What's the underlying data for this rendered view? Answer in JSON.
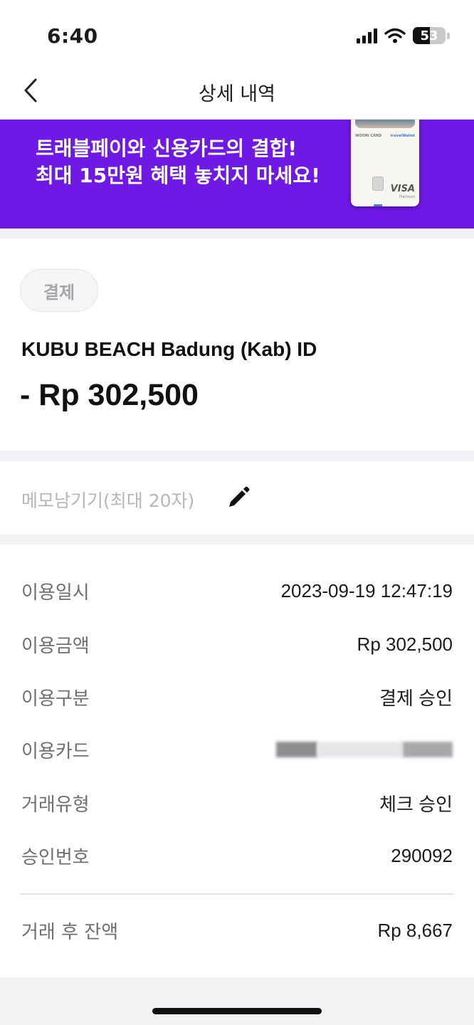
{
  "status_bar": {
    "time": "6:40",
    "battery": "53",
    "battery_level": 0.53
  },
  "nav": {
    "title": "상세 내역"
  },
  "banner": {
    "line1": "트래블페이와 신용카드의 결합!",
    "line2": "최대 15만원 혜택 놓치지 마세요!",
    "card_brand": "WOORI CARD",
    "card_wallet": "travelWallet",
    "card_network": "VISA",
    "card_tier": "Platinum"
  },
  "transaction": {
    "badge": "결제",
    "merchant": "KUBU BEACH Badung (Kab) ID",
    "amount": "- Rp 302,500"
  },
  "memo": {
    "placeholder": "메모남기기(최대 20자)"
  },
  "details": {
    "rows": [
      {
        "label": "이용일시",
        "value": "2023-09-19 12:47:19"
      },
      {
        "label": "이용금액",
        "value": "Rp 302,500"
      },
      {
        "label": "이용구분",
        "value": "결제 승인"
      },
      {
        "label": "이용카드",
        "value": ""
      },
      {
        "label": "거래유형",
        "value": "체크 승인"
      },
      {
        "label": "승인번호",
        "value": "290092"
      }
    ],
    "balance_label": "거래 후 잔액",
    "balance_value": "Rp 8,667"
  }
}
